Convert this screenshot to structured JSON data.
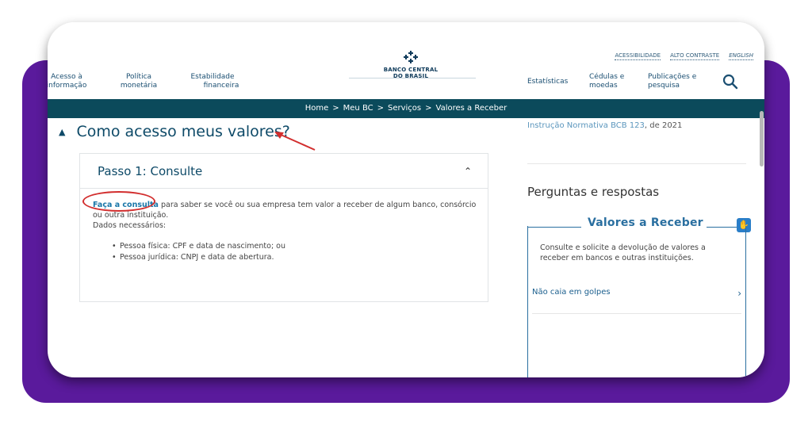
{
  "topbar": {
    "accessibility": "ACESSIBILIDADE",
    "contrast": "ALTO CONTRASTE",
    "english": "ENGLISH"
  },
  "nav_left": [
    {
      "line1": "Acesso à",
      "line2": "informação"
    },
    {
      "line1": "Política",
      "line2": "monetária"
    },
    {
      "line1": "Estabilidade",
      "line2": "financeira"
    }
  ],
  "logo": {
    "line1": "BANCO CENTRAL",
    "line2": "DO BRASIL",
    "mark": "⚘"
  },
  "nav_right": [
    {
      "line1": "Estatísticas",
      "line2": ""
    },
    {
      "line1": "Cédulas e",
      "line2": "moedas"
    },
    {
      "line1": "Publicações e",
      "line2": "pesquisa"
    }
  ],
  "breadcrumb": [
    "Home",
    "Meu BC",
    "Serviços",
    "Valores a Receber"
  ],
  "breadcrumb_sep": ">",
  "section": {
    "title": "Como acesso meus valores?"
  },
  "step": {
    "title": "Passo 1: Consulte",
    "link": "Faça a consulta",
    "text": " para saber se você ou sua empresa tem valor a receber de algum banco, consórcio ou outra instituição.",
    "required_label": "Dados necessários:",
    "bullets": [
      "Pessoa física: CPF e data de nascimento; ou",
      "Pessoa jurídica: CNPJ e data de abertura."
    ]
  },
  "side": {
    "note_link": "Instrução Normativa BCB 123",
    "note_rest": ", de 2021",
    "faq_title": "Perguntas e respostas",
    "vr_title": "Valores a Receber",
    "vr_desc": "Consulte e solicite a devolução de valores a receber em bancos e outras instituições.",
    "vr_link": "Não caia em golpes"
  },
  "colors": {
    "purple": "#5a1a9c",
    "navbar": "#0b4a5b",
    "accent": "#2a6fa0",
    "annotation_red": "#d22e2e"
  }
}
